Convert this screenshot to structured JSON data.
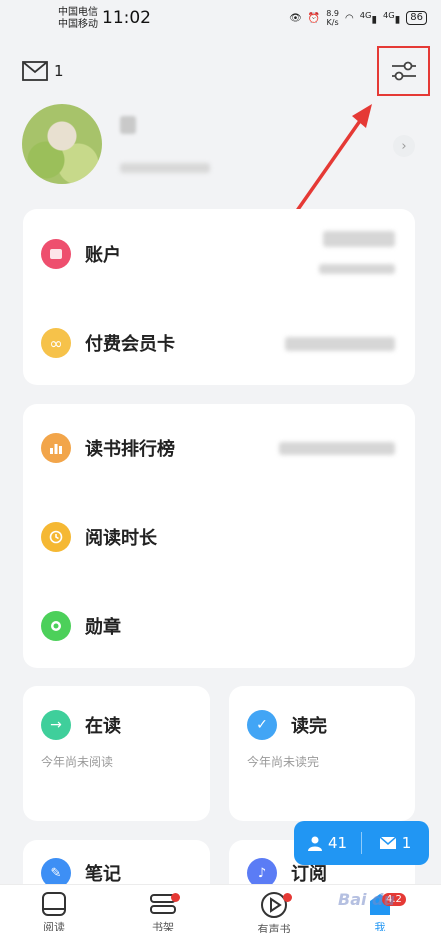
{
  "status_bar": {
    "carrier1": "中国电信",
    "carrier2": "中国移动",
    "time": "11:02",
    "speed_value": "8.9",
    "speed_unit": "K/s",
    "net1": "4G",
    "net2": "4G",
    "battery": "86"
  },
  "header": {
    "mail_count": "1"
  },
  "profile": {
    "chevron": "›"
  },
  "account_card": {
    "items": [
      {
        "label": "账户",
        "icon": "wallet-icon",
        "color": "#ee4f6e"
      },
      {
        "label": "付费会员卡",
        "icon": "infinity-icon",
        "color": "#f6c24a"
      }
    ]
  },
  "reading_card": {
    "items": [
      {
        "label": "读书排行榜",
        "icon": "bar-chart-icon",
        "color": "#f2a54a"
      },
      {
        "label": "阅读时长",
        "icon": "clock-icon",
        "color": "#f5b833"
      },
      {
        "label": "勋章",
        "icon": "medal-icon",
        "color": "#4cd05a"
      }
    ]
  },
  "tiles": [
    {
      "title": "在读",
      "subtitle": "今年尚未阅读",
      "icon": "arrow-right-icon",
      "color": "#3fcf9b"
    },
    {
      "title": "读完",
      "subtitle": "今年尚未读完",
      "icon": "check-icon",
      "color": "#42a5f5"
    },
    {
      "title": "笔记",
      "icon": "pen-icon",
      "color": "#3d8ff5"
    },
    {
      "title": "订阅",
      "icon": "bell-icon",
      "color": "#5b7cf5"
    }
  ],
  "float_badge": {
    "followers": "41",
    "messages": "1"
  },
  "bottom_nav": {
    "items": [
      {
        "label": "阅读",
        "icon": "tablet-icon"
      },
      {
        "label": "书架",
        "icon": "bookshelf-icon"
      },
      {
        "label": "有声书",
        "icon": "play-icon"
      },
      {
        "label": "我",
        "icon": "profile-icon"
      }
    ],
    "badge": "4.2",
    "watermark": "Bai du"
  },
  "colors": {
    "accent": "#2196f3",
    "highlight": "#e53935"
  }
}
